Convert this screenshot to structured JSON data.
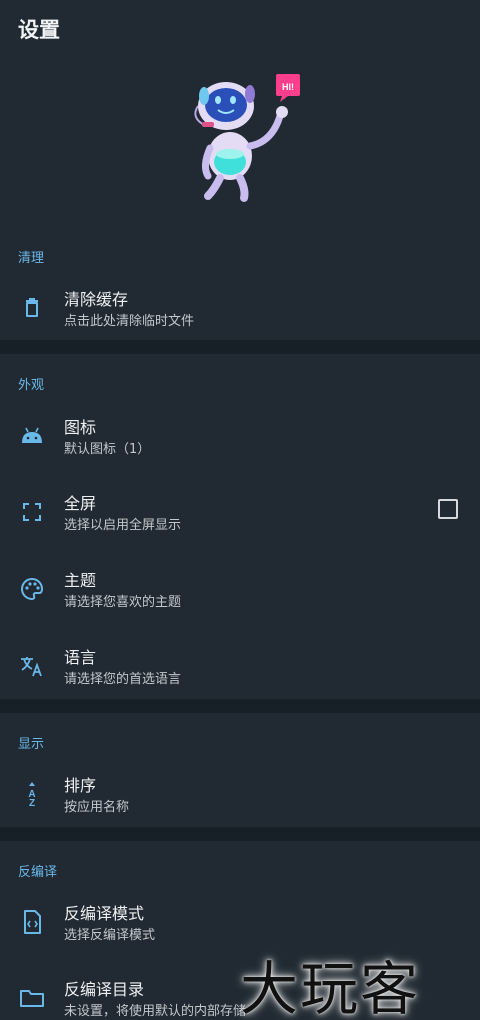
{
  "header": {
    "title": "设置"
  },
  "mascot": {
    "bubble_text": "HI!"
  },
  "colors": {
    "accent": "#6ab7ea",
    "background": "#212a32",
    "divider": "#182027"
  },
  "sections": {
    "clean": {
      "header": "清理",
      "items": {
        "clear_cache": {
          "icon": "trash-icon",
          "label": "清除缓存",
          "sub": "点击此处清除临时文件"
        }
      }
    },
    "appearance": {
      "header": "外观",
      "items": {
        "icon": {
          "icon": "android-icon",
          "label": "图标",
          "sub": "默认图标（1）"
        },
        "fullscreen": {
          "icon": "fullscreen-icon",
          "label": "全屏",
          "sub": "选择以启用全屏显示",
          "checked": false
        },
        "theme": {
          "icon": "palette-icon",
          "label": "主题",
          "sub": "请选择您喜欢的主题"
        },
        "language": {
          "icon": "translate-icon",
          "label": "语言",
          "sub": "请选择您的首选语言"
        }
      }
    },
    "display": {
      "header": "显示",
      "items": {
        "sort": {
          "icon": "sort-az-icon",
          "label": "排序",
          "sub": "按应用名称"
        }
      }
    },
    "decompile": {
      "header": "反编译",
      "items": {
        "mode": {
          "icon": "code-file-icon",
          "label": "反编译模式",
          "sub": "选择反编译模式"
        },
        "directory": {
          "icon": "folder-icon",
          "label": "反编译目录",
          "sub": "未设置，将使用默认的内部存储"
        }
      }
    }
  },
  "watermark": {
    "text": "大玩客"
  }
}
